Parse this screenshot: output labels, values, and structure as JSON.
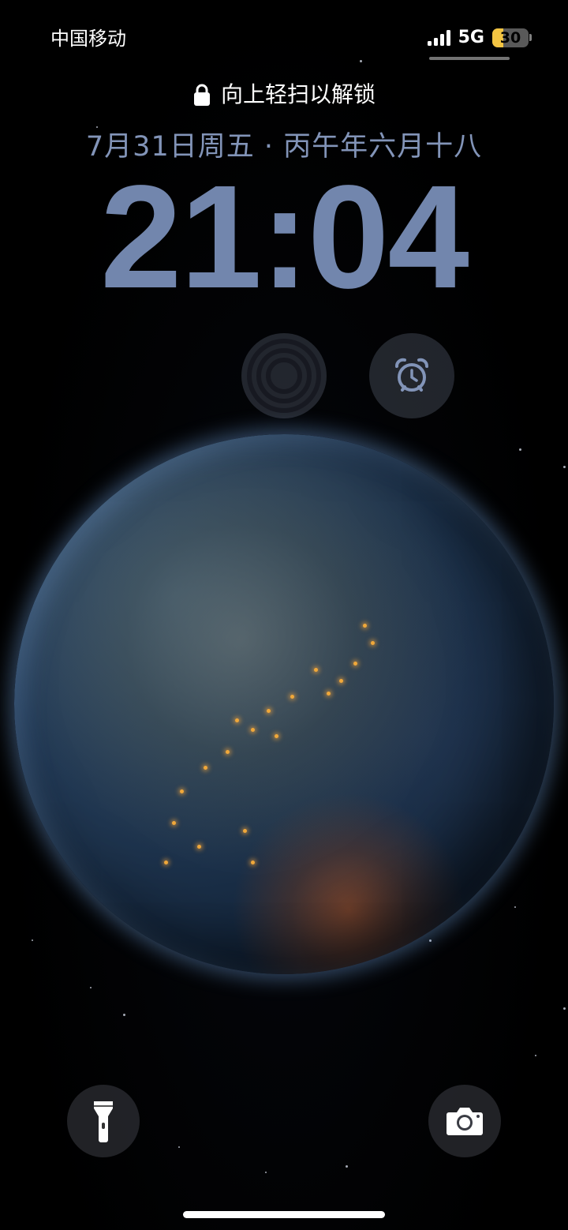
{
  "status_bar": {
    "carrier": "中国移动",
    "network": "5G",
    "battery_percent": "30",
    "battery_level": 0.3,
    "battery_color": "#f4c542",
    "signal_icon": "signal-bars-icon"
  },
  "lock_screen": {
    "unlock_hint": "向上轻扫以解锁",
    "lock_icon": "lock-icon",
    "date": "7月31日周五 · 丙午年六月十八",
    "time": "21:04",
    "time_color": "#7286ad",
    "date_color": "#8294b8"
  },
  "widgets": [
    {
      "name": "focus-widget",
      "icon": "focus-rings-icon"
    },
    {
      "name": "alarm-widget",
      "icon": "alarm-clock-icon"
    }
  ],
  "wallpaper": {
    "subject": "earth-globe",
    "atmosphere_color": "#6ea0dc"
  },
  "quick_actions": {
    "flashlight_icon": "flashlight-icon",
    "camera_icon": "camera-icon"
  }
}
